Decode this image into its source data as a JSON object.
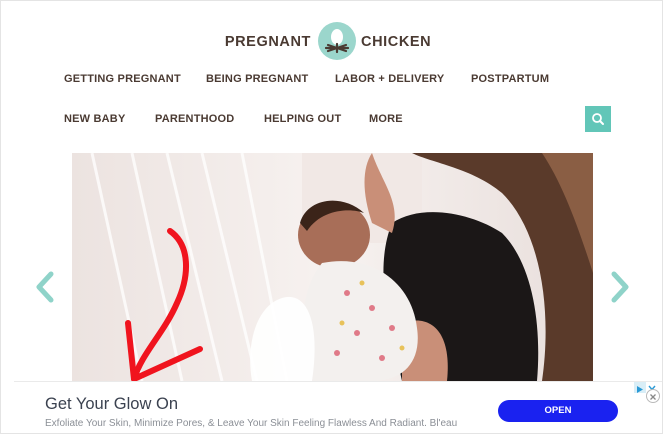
{
  "brand": {
    "left_word": "PREGNANT",
    "right_word": "CHICKEN",
    "badge_color": "#9bd6cc",
    "text_color": "#4a3a32"
  },
  "nav": {
    "row1": [
      "GETTING PREGNANT",
      "BEING PREGNANT",
      "LABOR + DELIVERY",
      "POSTPARTUM"
    ],
    "row2": [
      "NEW BABY",
      "PARENTHOOD",
      "HELPING OUT",
      "MORE"
    ],
    "search_icon": "search-icon",
    "accent": "#62c6b8"
  },
  "hero": {
    "prev_icon": "chevron-left-icon",
    "next_icon": "chevron-right-icon",
    "annotation_icon": "hand-drawn-red-arrow-icon",
    "annotation_color": "#f0141e"
  },
  "ad": {
    "title": "Get Your Glow On",
    "description": "Exfoliate Your Skin, Minimize Pores, & Leave Your Skin Feeling Flawless And Radiant. Bl'eau",
    "cta": "OPEN",
    "cta_color": "#1a22f0",
    "choices_icon": "adchoices-icon",
    "close_icon": "close-icon"
  }
}
